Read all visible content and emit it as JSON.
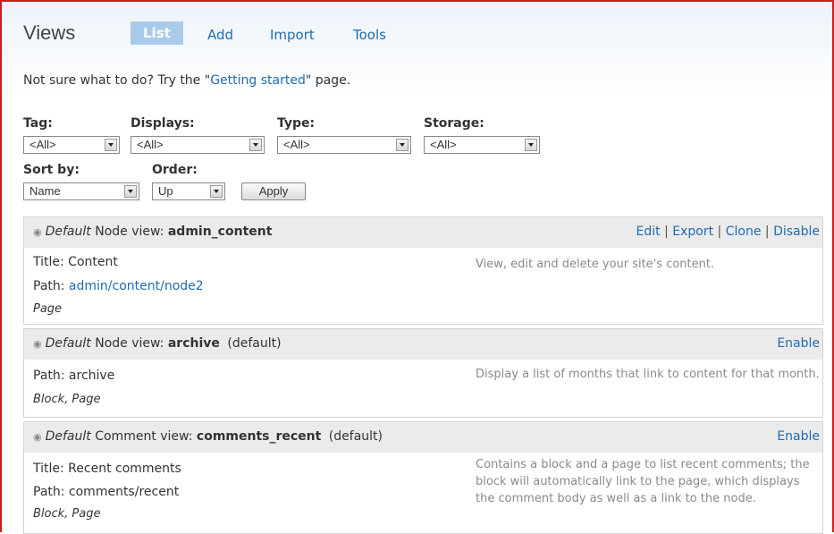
{
  "header": {
    "title": "Views",
    "tabs": [
      {
        "label": "List",
        "active": true
      },
      {
        "label": "Add"
      },
      {
        "label": "Import"
      },
      {
        "label": "Tools"
      }
    ]
  },
  "help": {
    "prefix": "Not sure what to do? Try the \"",
    "link": "Getting started",
    "suffix": "\" page."
  },
  "filters": {
    "tag": {
      "label": "Tag:",
      "value": "<All>"
    },
    "displays": {
      "label": "Displays:",
      "value": "<All>"
    },
    "type": {
      "label": "Type:",
      "value": "<All>"
    },
    "storage": {
      "label": "Storage:",
      "value": "<All>"
    },
    "sort_by": {
      "label": "Sort by:",
      "value": "Name"
    },
    "order": {
      "label": "Order:",
      "value": "Up"
    },
    "apply_label": "Apply"
  },
  "views": [
    {
      "storage": "Default",
      "type_label": "Node view:",
      "name": "admin_content",
      "default_tag": "",
      "actions": [
        "Edit",
        "Export",
        "Clone",
        "Disable"
      ],
      "title_line": "Title: Content",
      "path_prefix": "Path: ",
      "path": "admin/content/node2",
      "displays": "Page",
      "description": "View, edit and delete your site's content."
    },
    {
      "storage": "Default",
      "type_label": "Node view:",
      "name": "archive",
      "default_tag": "(default)",
      "actions": [
        "Enable"
      ],
      "path_line": "Path: archive",
      "displays": "Block, Page",
      "description": "Display a list of months that link to content for that month."
    },
    {
      "storage": "Default",
      "type_label": "Comment view:",
      "name": "comments_recent",
      "default_tag": "(default)",
      "actions": [
        "Enable"
      ],
      "title_line": "Title: Recent comments",
      "path_line": "Path: comments/recent",
      "displays": "Block, Page",
      "description": "Contains a block and a page to list recent comments; the block will automatically link to the page, which displays the comment body as well as a link to the node."
    }
  ],
  "separator": "|",
  "colors": {
    "link": "#1f6bb0",
    "active_tab": "#a9cbea",
    "view_header": "#ebebeb",
    "frame": "#cc1d1d"
  }
}
